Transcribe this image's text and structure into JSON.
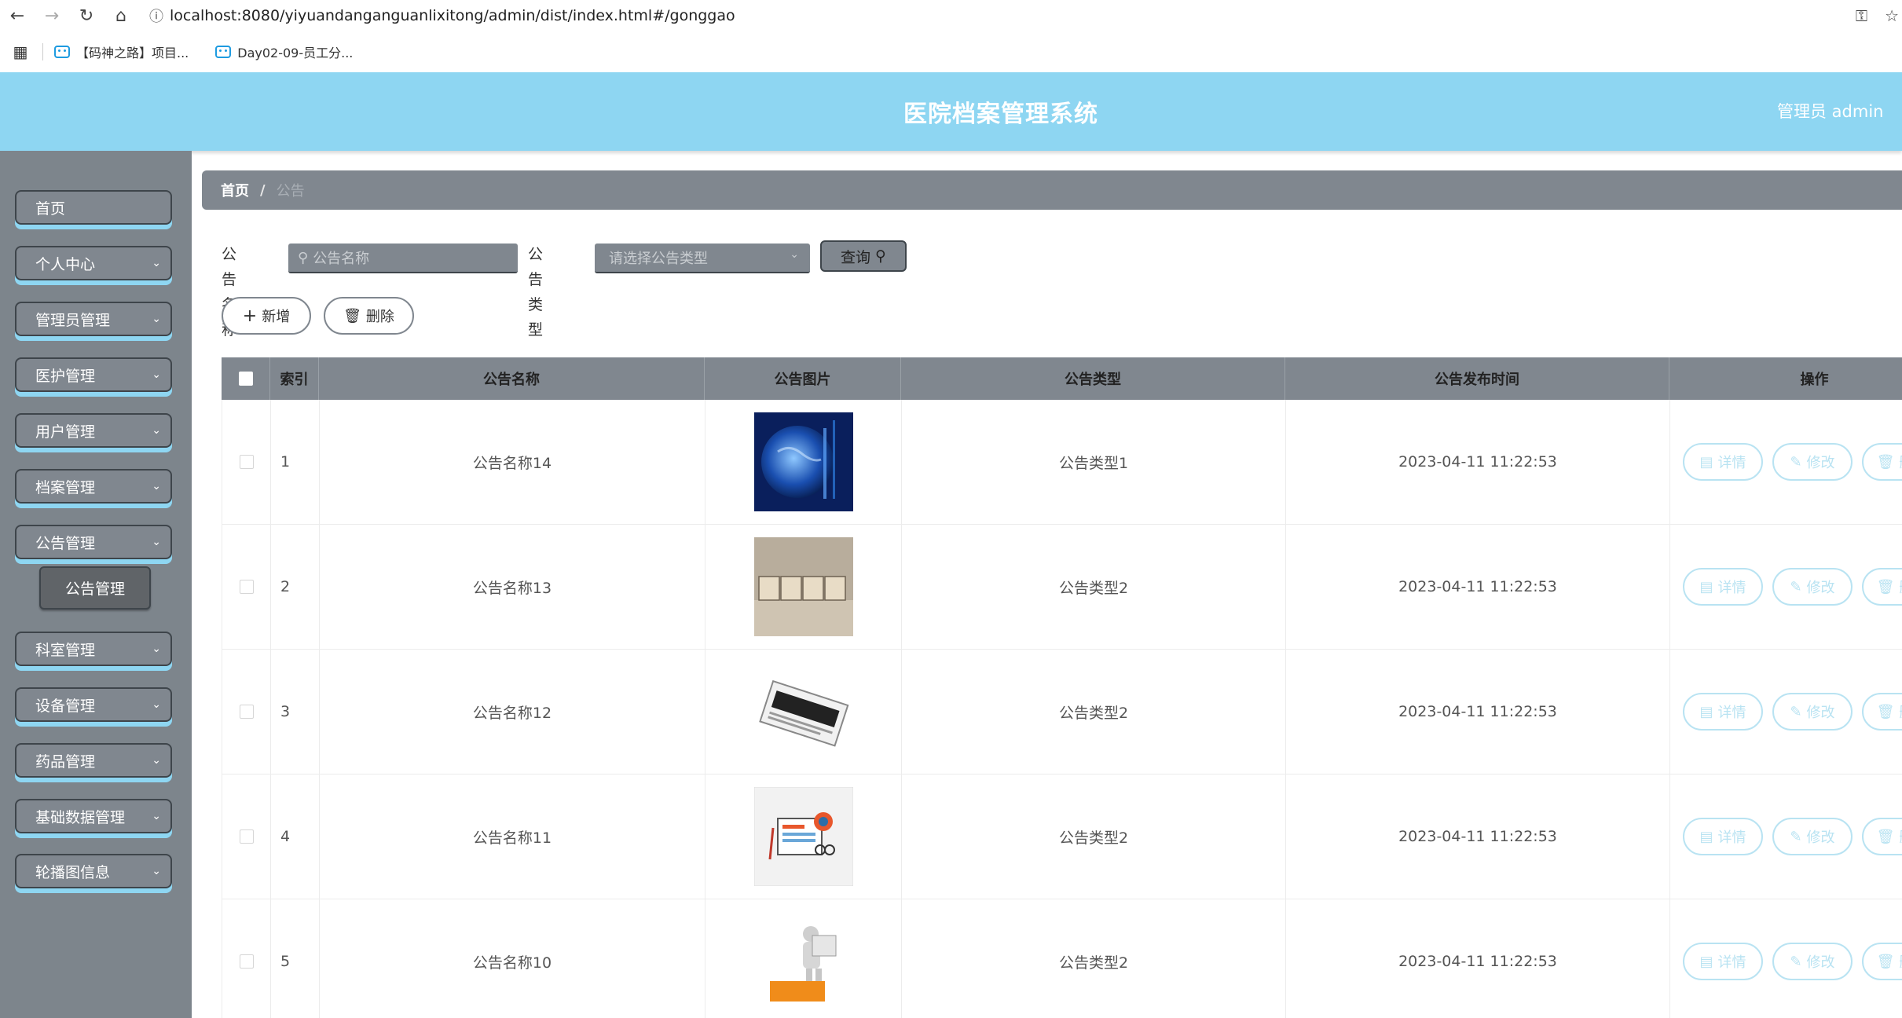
{
  "browser": {
    "url": "localhost:8080/yiyuandanganguanlixitong/admin/dist/index.html#/gonggao",
    "bookmarks": [
      "【码神之路】项目...",
      "Day02-09-员工分..."
    ]
  },
  "app": {
    "title": "医院档案管理系统",
    "user": "管理员 admin"
  },
  "sidebar": {
    "items": [
      {
        "label": "首页",
        "has_chevron": false
      },
      {
        "label": "个人中心",
        "has_chevron": true
      },
      {
        "label": "管理员管理",
        "has_chevron": true
      },
      {
        "label": "医护管理",
        "has_chevron": true
      },
      {
        "label": "用户管理",
        "has_chevron": true
      },
      {
        "label": "档案管理",
        "has_chevron": true
      },
      {
        "label": "公告管理",
        "has_chevron": true
      },
      {
        "label": "科室管理",
        "has_chevron": true
      },
      {
        "label": "设备管理",
        "has_chevron": true
      },
      {
        "label": "药品管理",
        "has_chevron": true
      },
      {
        "label": "基础数据管理",
        "has_chevron": true
      },
      {
        "label": "轮播图信息",
        "has_chevron": true
      }
    ],
    "active_sub": "公告管理"
  },
  "breadcrumb": {
    "home": "首页",
    "separator": "/",
    "current": "公告"
  },
  "search": {
    "name_label": "公告名称",
    "name_placeholder": "公告名称",
    "type_label": "公告类型",
    "type_placeholder": "请选择公告类型",
    "query_button": "查询"
  },
  "actions": {
    "add": "新增",
    "delete": "删除"
  },
  "table": {
    "headers": [
      "索引",
      "公告名称",
      "公告图片",
      "公告类型",
      "公告发布时间",
      "操作"
    ],
    "rows": [
      {
        "index": "1",
        "name": "公告名称14",
        "image": "globe-image",
        "type": "公告类型1",
        "time": "2023-04-11 11:22:53"
      },
      {
        "index": "2",
        "name": "公告名称13",
        "image": "news-blocks-image",
        "type": "公告类型2",
        "time": "2023-04-11 11:22:53"
      },
      {
        "index": "3",
        "name": "公告名称12",
        "image": "newspaper-image",
        "type": "公告类型2",
        "time": "2023-04-11 11:22:53"
      },
      {
        "index": "4",
        "name": "公告名称11",
        "image": "news-illustration-image",
        "type": "公告类型2",
        "time": "2023-04-11 11:22:53"
      },
      {
        "index": "5",
        "name": "公告名称10",
        "image": "news-figure-image",
        "type": "公告类型2",
        "time": "2023-04-11 11:22:53"
      }
    ],
    "op_labels": {
      "detail": "详情",
      "edit": "修改"
    }
  },
  "colors": {
    "header_bg": "#8ed6f2",
    "sidebar_bg": "#7d858c",
    "accent_gray": "#80878f",
    "op_button": "#b9e3f2"
  }
}
